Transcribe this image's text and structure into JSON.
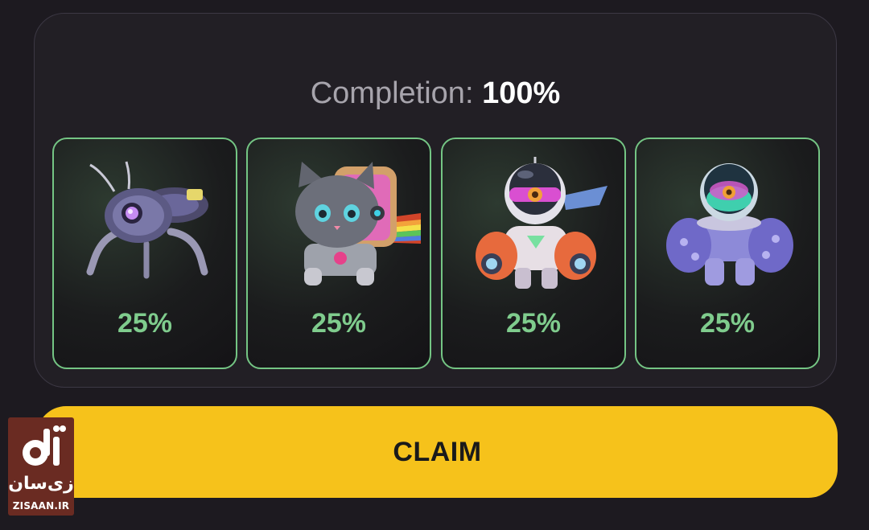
{
  "panel": {
    "completion_label": "Completion:",
    "completion_value": "100%"
  },
  "cards": [
    {
      "icon": "robot-spider-icon",
      "percent": "25%"
    },
    {
      "icon": "robot-cat-icon",
      "percent": "25%"
    },
    {
      "icon": "astronaut-robot-icon",
      "percent": "25%"
    },
    {
      "icon": "mech-suit-robot-icon",
      "percent": "25%"
    }
  ],
  "claim_label": "CLAIM",
  "watermark": {
    "brand_fa": "زی‌سان",
    "site": "ZISAAN.IR"
  },
  "colors": {
    "background": "#1d1a20",
    "card_border": "#74c584",
    "percent_text": "#7fcc8d",
    "claim_button": "#f6c21b"
  }
}
